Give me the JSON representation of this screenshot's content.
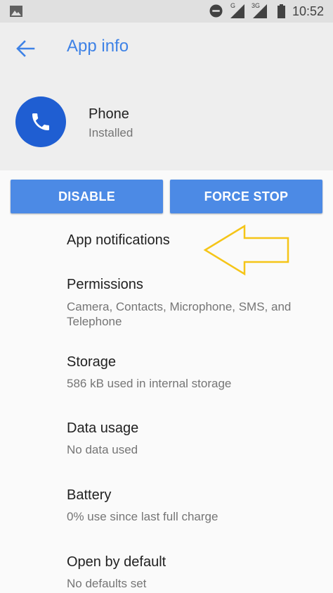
{
  "status_bar": {
    "time": "10:52",
    "signal1_tag": "G",
    "signal2_tag": "3G",
    "icons": [
      "image-notification-icon",
      "do-not-disturb-icon",
      "signal-icon",
      "signal-3g-icon",
      "battery-icon"
    ]
  },
  "header": {
    "title": "App info",
    "app_name": "Phone",
    "app_status": "Installed",
    "accent_color": "#3e82e6"
  },
  "buttons": {
    "disable": "DISABLE",
    "force_stop": "FORCE STOP",
    "color": "#4c8ae5"
  },
  "items": [
    {
      "title": "App notifications"
    },
    {
      "title": "Permissions",
      "subtitle": "Camera, Contacts, Microphone, SMS, and Telephone"
    },
    {
      "title": "Storage",
      "subtitle": "586 kB used in internal storage"
    },
    {
      "title": "Data usage",
      "subtitle": "No data used"
    },
    {
      "title": "Battery",
      "subtitle": "0% use since last full charge"
    },
    {
      "title": "Open by default",
      "subtitle": "No defaults set"
    }
  ],
  "annotation": {
    "arrow_color": "#f5c518"
  }
}
